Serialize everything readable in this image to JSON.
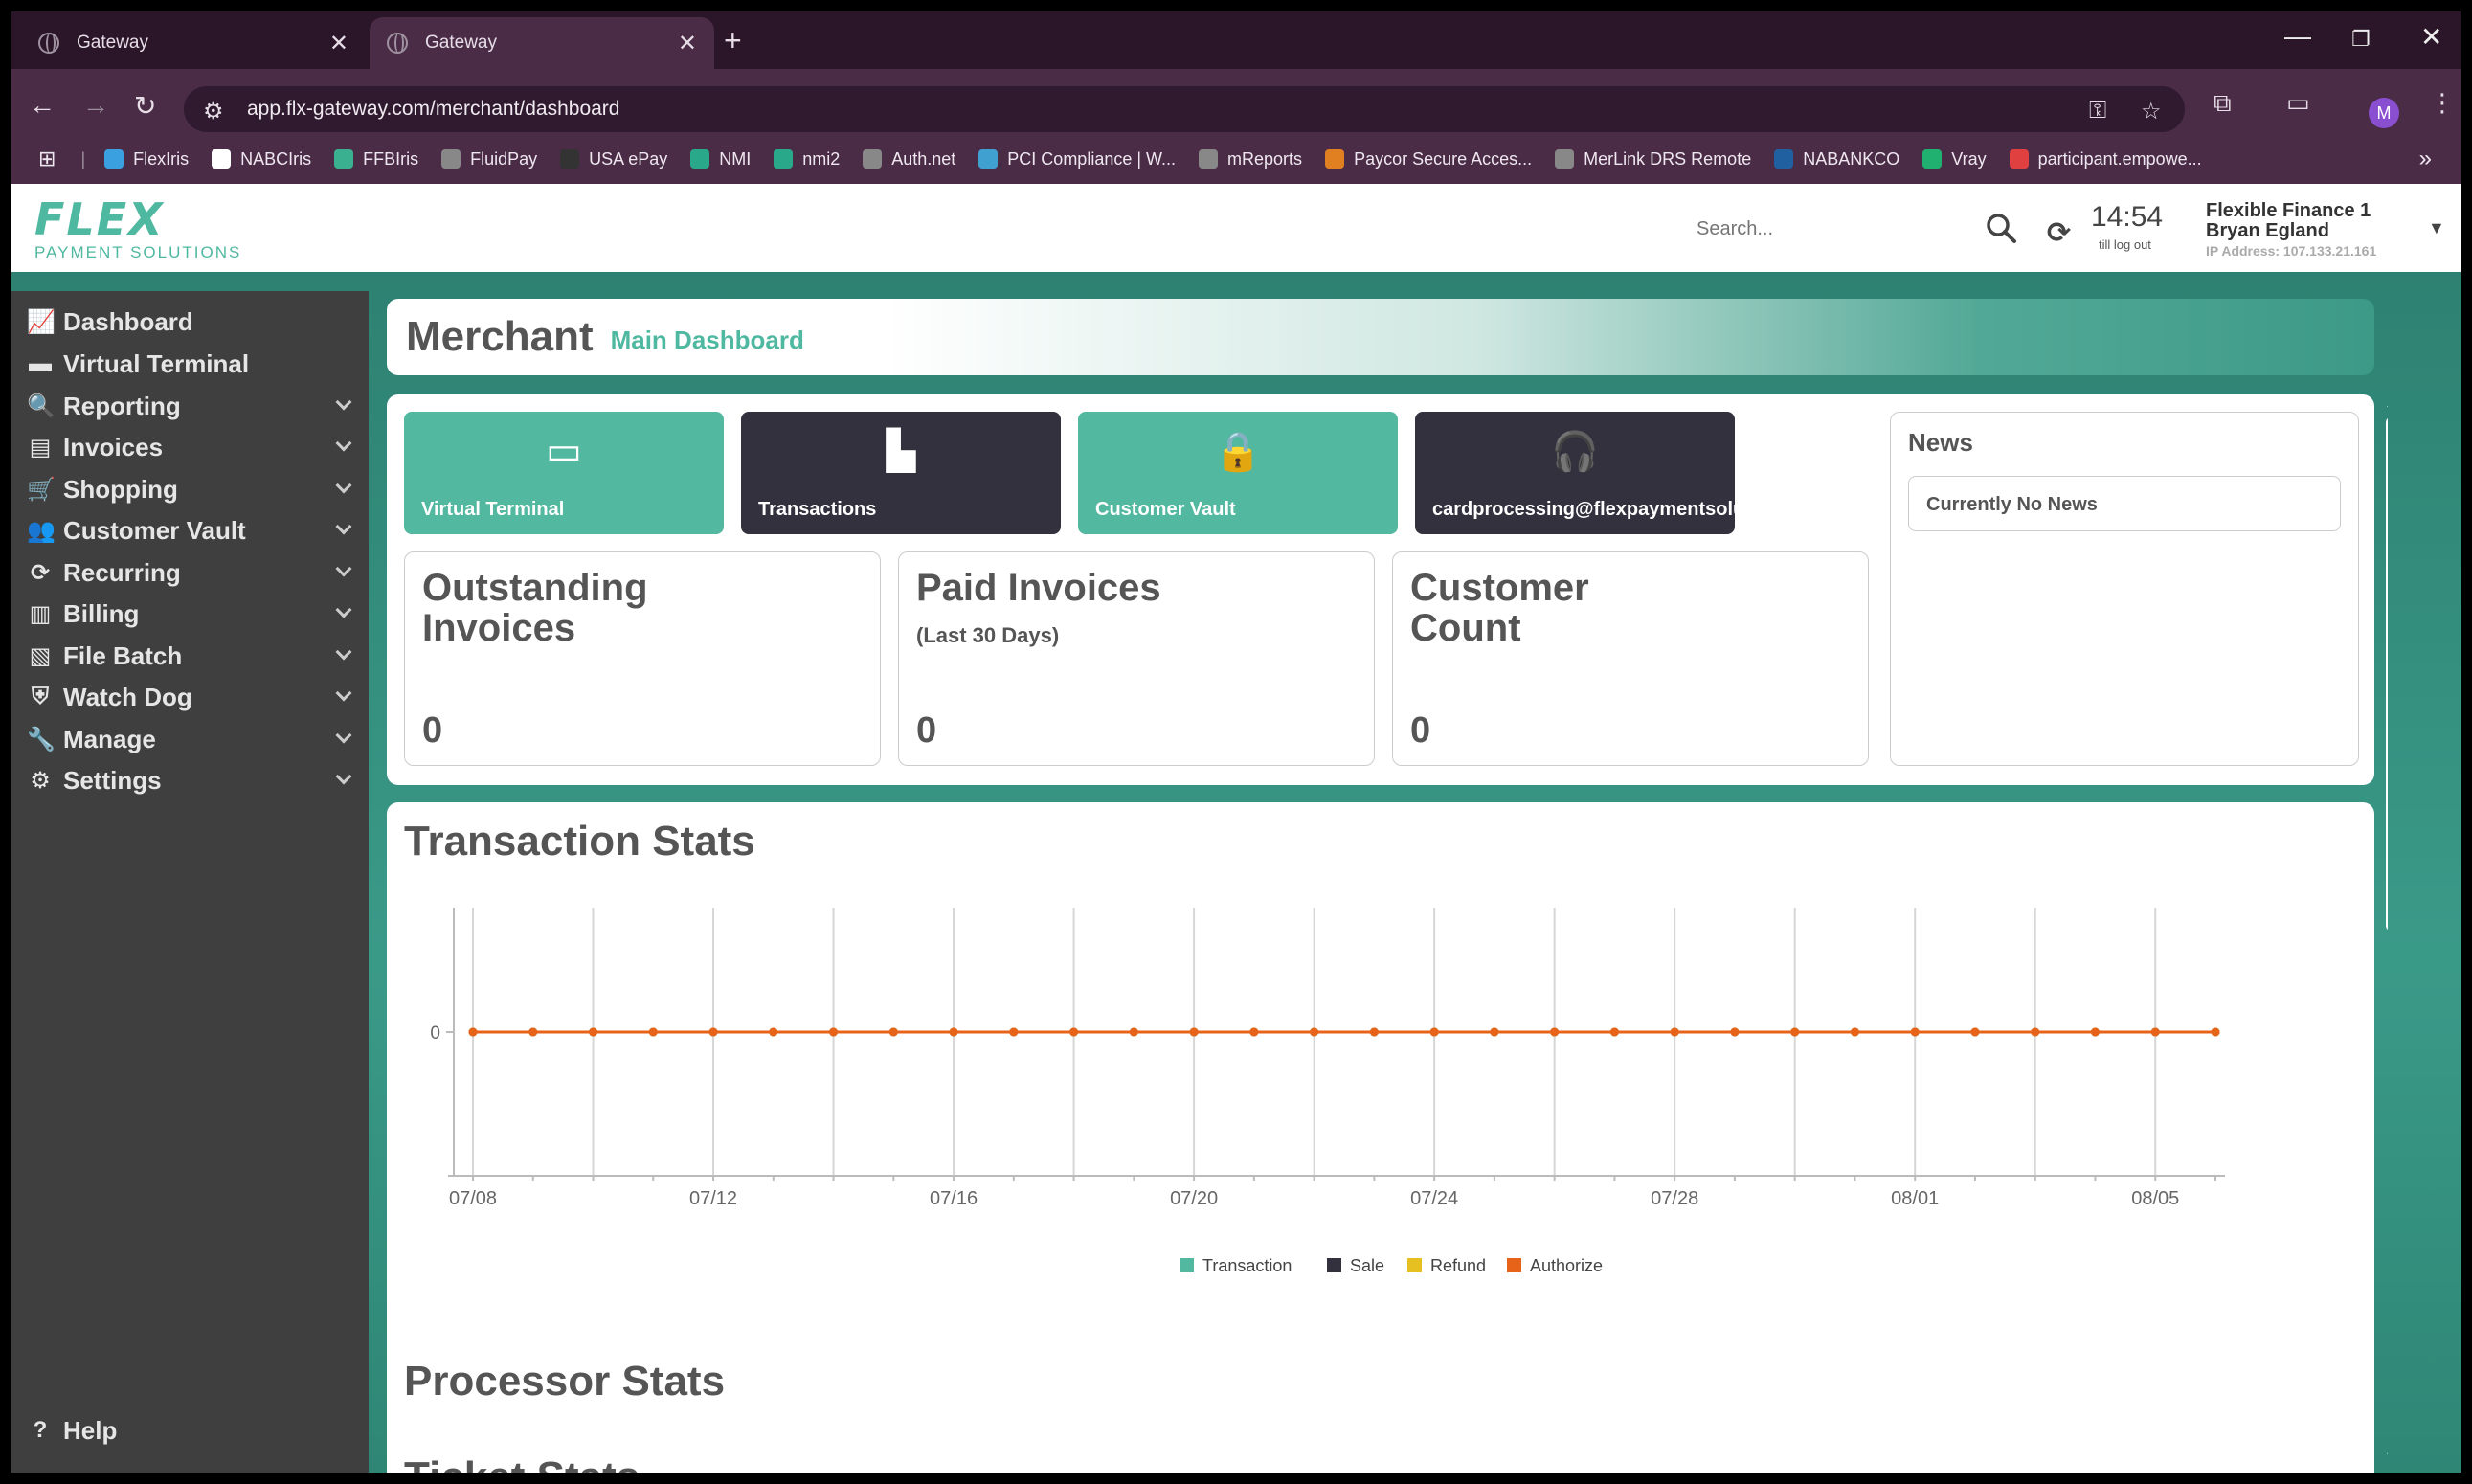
{
  "browser": {
    "tabs": [
      {
        "title": "Gateway"
      },
      {
        "title": "Gateway"
      }
    ],
    "url": "app.flx-gateway.com/merchant/dashboard",
    "profile_initial": "M",
    "bookmarks": [
      {
        "label": "FlexIris",
        "color": "#3aa0e0"
      },
      {
        "label": "NABCIris",
        "color": "#ffffff"
      },
      {
        "label": "FFBIris",
        "color": "#3ab090"
      },
      {
        "label": "FluidPay",
        "color": "#888888"
      },
      {
        "label": "USA ePay",
        "color": "#333333"
      },
      {
        "label": "NMI",
        "color": "#2aa88a"
      },
      {
        "label": "nmi2",
        "color": "#2aa88a"
      },
      {
        "label": "Auth.net",
        "color": "#888888"
      },
      {
        "label": "PCI Compliance | W...",
        "color": "#40a0d0"
      },
      {
        "label": "mReports",
        "color": "#888888"
      },
      {
        "label": "Paycor Secure Acces...",
        "color": "#e08020"
      },
      {
        "label": "MerLink DRS Remote",
        "color": "#888888"
      },
      {
        "label": "NABANKCO",
        "color": "#2060a0"
      },
      {
        "label": "Vray",
        "color": "#20b070"
      },
      {
        "label": "participant.empowe...",
        "color": "#e04040"
      }
    ]
  },
  "header": {
    "logo_main": "FLEX",
    "logo_sub": "PAYMENT SOLUTIONS",
    "search_placeholder": "Search...",
    "timer": "14:54",
    "timer_label": "till log out",
    "account": "Flexible Finance 1",
    "user": "Bryan Egland",
    "ip": "IP Address: 107.133.21.161"
  },
  "sidebar": {
    "items": [
      {
        "label": "Dashboard",
        "icon": "chart-line-icon",
        "glyph": "📈"
      },
      {
        "label": "Virtual Terminal",
        "icon": "credit-card-icon",
        "glyph": "▬"
      },
      {
        "label": "Reporting",
        "icon": "search-icon",
        "glyph": "🔍"
      },
      {
        "label": "Invoices",
        "icon": "invoice-icon",
        "glyph": "▤"
      },
      {
        "label": "Shopping",
        "icon": "cart-icon",
        "glyph": "🛒"
      },
      {
        "label": "Customer Vault",
        "icon": "users-icon",
        "glyph": "👥"
      },
      {
        "label": "Recurring",
        "icon": "refresh-icon",
        "glyph": "⟳"
      },
      {
        "label": "Billing",
        "icon": "receipt-icon",
        "glyph": "▥"
      },
      {
        "label": "File Batch",
        "icon": "csv-file-icon",
        "glyph": "▧"
      },
      {
        "label": "Watch Dog",
        "icon": "shield-icon",
        "glyph": "⛨"
      },
      {
        "label": "Manage",
        "icon": "wrench-icon",
        "glyph": "🔧"
      },
      {
        "label": "Settings",
        "icon": "gear-icon",
        "glyph": "⚙"
      }
    ],
    "help": "Help"
  },
  "page": {
    "title": "Merchant",
    "subtitle": "Main Dashboard"
  },
  "quick_links": [
    {
      "label": "Virtual Terminal",
      "icon": "credit-card-icon",
      "glyph": "▭",
      "style": "teal"
    },
    {
      "label": "Transactions",
      "icon": "bar-chart-icon",
      "glyph": "▙",
      "style": "dark"
    },
    {
      "label": "Customer Vault",
      "icon": "lock-icon",
      "glyph": "🔒",
      "style": "teal"
    },
    {
      "label": "cardprocessing@flexpaymentsolutions.com",
      "icon": "headset-icon",
      "glyph": "🎧",
      "style": "dark"
    }
  ],
  "stats": {
    "outstanding": {
      "title": "Outstanding Invoices",
      "value": "0"
    },
    "paid": {
      "title": "Paid Invoices",
      "subtitle": "(Last 30 Days)",
      "value": "0"
    },
    "customers": {
      "title": "Customer Count",
      "value": "0"
    }
  },
  "news": {
    "title": "News",
    "body": "Currently No News"
  },
  "transaction_stats": {
    "title": "Transaction Stats"
  },
  "processor_stats": {
    "title": "Processor Stats"
  },
  "partial_heading": "Ticket Stats",
  "chart_data": {
    "type": "line",
    "title": "Transaction Stats",
    "x": [
      "07/08",
      "07/09",
      "07/10",
      "07/11",
      "07/12",
      "07/13",
      "07/14",
      "07/15",
      "07/16",
      "07/17",
      "07/18",
      "07/19",
      "07/20",
      "07/21",
      "07/22",
      "07/23",
      "07/24",
      "07/25",
      "07/26",
      "07/27",
      "07/28",
      "07/29",
      "07/30",
      "07/31",
      "08/01",
      "08/02",
      "08/03",
      "08/04",
      "08/05",
      "08/06"
    ],
    "x_tick_labels": [
      "07/08",
      "07/12",
      "07/16",
      "07/20",
      "07/24",
      "07/28",
      "08/01",
      "08/05"
    ],
    "y_tick_labels": [
      "0"
    ],
    "series": [
      {
        "name": "Transaction",
        "color": "#52b8a0",
        "values": [
          0,
          0,
          0,
          0,
          0,
          0,
          0,
          0,
          0,
          0,
          0,
          0,
          0,
          0,
          0,
          0,
          0,
          0,
          0,
          0,
          0,
          0,
          0,
          0,
          0,
          0,
          0,
          0,
          0,
          0
        ]
      },
      {
        "name": "Sale",
        "color": "#33313d",
        "values": [
          0,
          0,
          0,
          0,
          0,
          0,
          0,
          0,
          0,
          0,
          0,
          0,
          0,
          0,
          0,
          0,
          0,
          0,
          0,
          0,
          0,
          0,
          0,
          0,
          0,
          0,
          0,
          0,
          0,
          0
        ]
      },
      {
        "name": "Refund",
        "color": "#e6c020",
        "values": [
          0,
          0,
          0,
          0,
          0,
          0,
          0,
          0,
          0,
          0,
          0,
          0,
          0,
          0,
          0,
          0,
          0,
          0,
          0,
          0,
          0,
          0,
          0,
          0,
          0,
          0,
          0,
          0,
          0,
          0
        ]
      },
      {
        "name": "Authorize",
        "color": "#e8631a",
        "values": [
          0,
          0,
          0,
          0,
          0,
          0,
          0,
          0,
          0,
          0,
          0,
          0,
          0,
          0,
          0,
          0,
          0,
          0,
          0,
          0,
          0,
          0,
          0,
          0,
          0,
          0,
          0,
          0,
          0,
          0
        ]
      }
    ],
    "legend": "bottom-center",
    "grid": true
  }
}
